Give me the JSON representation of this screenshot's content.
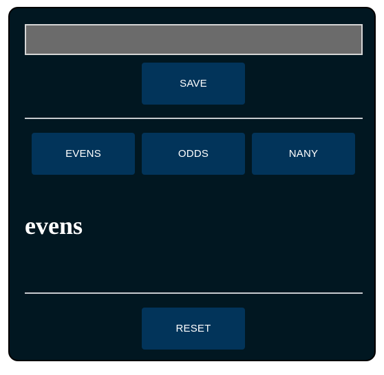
{
  "input": {
    "value": "",
    "placeholder": ""
  },
  "buttons": {
    "save_label": "SAVE",
    "evens_label": "EVENS",
    "odds_label": "ODDS",
    "nany_label": "NANY",
    "reset_label": "RESET"
  },
  "result": {
    "text": "evens"
  },
  "colors": {
    "panel_background": "#011721",
    "button_background": "#02345a",
    "input_background": "#6b6b6b",
    "divider": "#c8ccd0",
    "text": "#ffffff"
  }
}
